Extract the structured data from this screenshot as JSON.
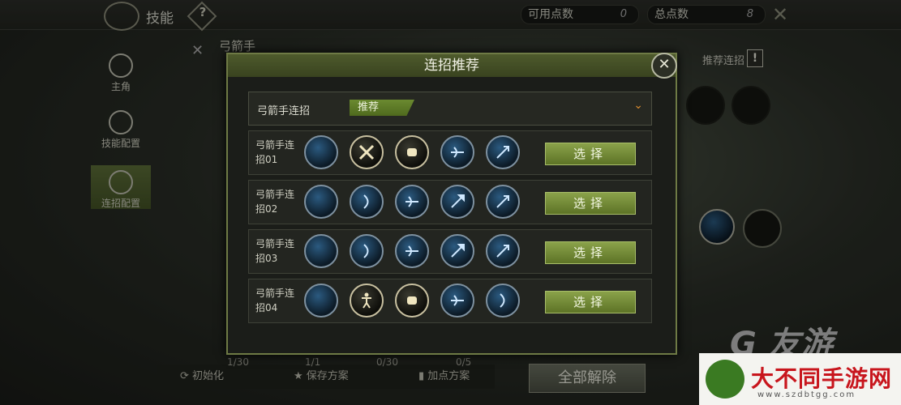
{
  "header": {
    "title": "技能",
    "help": "?",
    "available_points_label": "可用点数",
    "available_points_value": "0",
    "total_points_label": "总点数",
    "total_points_value": "8"
  },
  "sidebar": {
    "items": [
      {
        "label": "主角",
        "icon": "lightning-icon"
      },
      {
        "label": "技能配置",
        "icon": "swirl-icon"
      },
      {
        "label": "连招配置",
        "icon": "combo-icon",
        "active": true
      }
    ]
  },
  "main": {
    "class_name": "弓箭手",
    "recommend_combo": "推荐连招",
    "warn": "!"
  },
  "bottom": {
    "reset": "初始化",
    "save": "保存方案",
    "plan": "加点方案",
    "reset_all": "全部解除",
    "counts": [
      "1/30",
      "1/1",
      "0/30",
      "0/5"
    ]
  },
  "modal": {
    "title": "连招推荐",
    "dropdown_label": "弓箭手连招",
    "dropdown_tag": "推荐",
    "select_label": "选择",
    "combos": [
      {
        "name": "弓箭手连招01",
        "skills": [
          "orb",
          "crossed-swords",
          "fist",
          "bow",
          "arrow"
        ]
      },
      {
        "name": "弓箭手连招02",
        "skills": [
          "orb",
          "bow-draw",
          "bow",
          "spear",
          "arrow"
        ]
      },
      {
        "name": "弓箭手连招03",
        "skills": [
          "orb",
          "bow-draw",
          "bow",
          "spear",
          "arrow"
        ]
      },
      {
        "name": "弓箭手连招04",
        "skills": [
          "orb",
          "dancer",
          "fist",
          "bow",
          "bow-draw"
        ]
      }
    ]
  },
  "watermark": {
    "text": "大不同手游网",
    "url": "www.szdbtgg.com"
  },
  "colors": {
    "accent": "#6e7a45",
    "select": "#7a9436",
    "gold_icon": "#c8c0a0",
    "blue_icon": "#2b5a80"
  }
}
